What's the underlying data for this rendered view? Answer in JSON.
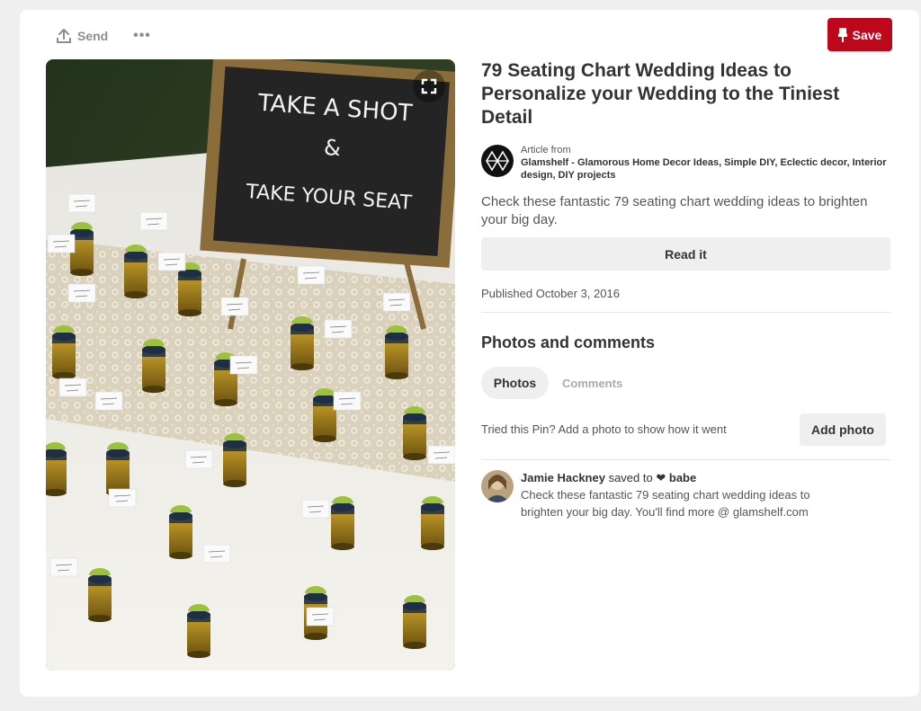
{
  "toolbar": {
    "send_label": "Send",
    "more_label": "•••",
    "save_label": "Save"
  },
  "pin": {
    "image_sign_line1": "TAKE A SHOT",
    "image_sign_amp": "&",
    "image_sign_line2": "TAKE YOUR SEAT",
    "title": "79 Seating Chart Wedding Ideas to Personalize your Wedding to the Tiniest Detail",
    "source_label": "Article from",
    "source_name": "Glamshelf - Glamorous Home Decor Ideas, Simple DIY, Eclectic decor, Interior design, DIY projects",
    "description": "Check these fantastic 79 seating chart wedding ideas to brighten your big day.",
    "read_label": "Read it",
    "published": "Published October 3, 2016"
  },
  "photos_comments": {
    "title": "Photos and comments",
    "tabs": [
      {
        "label": "Photos",
        "active": true
      },
      {
        "label": "Comments",
        "active": false
      }
    ],
    "tried_text": "Tried this Pin? Add a photo to show how it went",
    "add_photo_label": "Add photo"
  },
  "comment": {
    "user": "Jamie Hackney",
    "saved_to": "saved to",
    "heart": "❤",
    "board": "babe",
    "text": "Check these fantastic 79 seating chart wedding ideas to brighten your big day. You'll find more @ glamshelf.com"
  },
  "colors": {
    "save_red": "#bd081c",
    "button_gray": "#efefef",
    "page_bg": "#efefef"
  },
  "icons": {
    "send": "upload-arrow-icon",
    "save": "pushpin-icon",
    "expand": "expand-icon",
    "source_logo": "glamshelf-logo-icon"
  }
}
